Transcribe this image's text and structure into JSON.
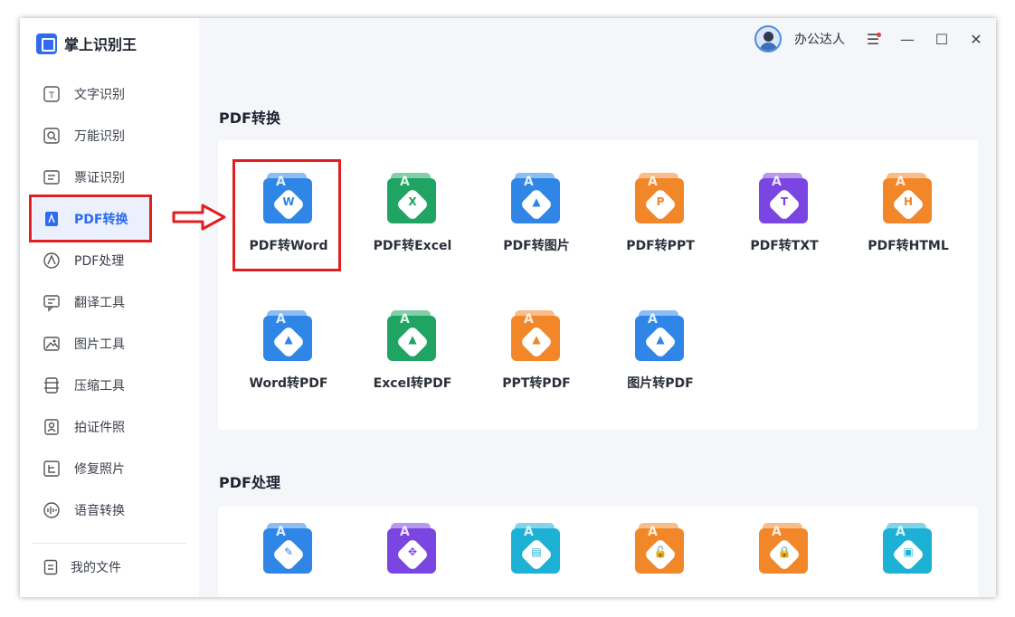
{
  "app": {
    "title": "掌上识别王"
  },
  "user": {
    "name": "办公达人"
  },
  "window": {
    "menu": "☰",
    "minimize": "—",
    "maximize": "☐",
    "close": "✕"
  },
  "sidebar": {
    "items": [
      {
        "label": "文字识别",
        "icon": "text-recognition-icon"
      },
      {
        "label": "万能识别",
        "icon": "universal-recognition-icon"
      },
      {
        "label": "票证识别",
        "icon": "ticket-recognition-icon"
      },
      {
        "label": "PDF转换",
        "icon": "pdf-convert-icon",
        "active": true
      },
      {
        "label": "PDF处理",
        "icon": "pdf-process-icon"
      },
      {
        "label": "翻译工具",
        "icon": "translate-icon"
      },
      {
        "label": "图片工具",
        "icon": "image-tools-icon"
      },
      {
        "label": "压缩工具",
        "icon": "compress-icon"
      },
      {
        "label": "拍证件照",
        "icon": "id-photo-icon"
      },
      {
        "label": "修复照片",
        "icon": "photo-repair-icon"
      },
      {
        "label": "语音转换",
        "icon": "voice-convert-icon"
      }
    ],
    "bottom": {
      "label": "我的文件",
      "icon": "my-files-icon"
    }
  },
  "sections": {
    "pdf_convert": {
      "title": "PDF转换",
      "tools": [
        {
          "label": "PDF转Word",
          "glyph": "W",
          "color": "#2f86e6",
          "accent": "#2f86e6"
        },
        {
          "label": "PDF转Excel",
          "glyph": "X",
          "color": "#1fa463",
          "accent": "#1fa463"
        },
        {
          "label": "PDF转图片",
          "glyph": "▲",
          "color": "#2f86e6",
          "accent": "#2f86e6"
        },
        {
          "label": "PDF转PPT",
          "glyph": "P",
          "color": "#f2872a",
          "accent": "#f2872a"
        },
        {
          "label": "PDF转TXT",
          "glyph": "T",
          "color": "#7a45e0",
          "accent": "#7a45e0"
        },
        {
          "label": "PDF转HTML",
          "glyph": "H",
          "color": "#f2872a",
          "accent": "#f2872a"
        },
        {
          "label": "Word转PDF",
          "glyph": "▲",
          "color": "#2f86e6",
          "accent": "#2f86e6"
        },
        {
          "label": "Excel转PDF",
          "glyph": "▲",
          "color": "#1fa463",
          "accent": "#1fa463"
        },
        {
          "label": "PPT转PDF",
          "glyph": "▲",
          "color": "#f2872a",
          "accent": "#f2872a"
        },
        {
          "label": "图片转PDF",
          "glyph": "▲",
          "color": "#2f86e6",
          "accent": "#2f86e6"
        }
      ]
    },
    "pdf_process": {
      "title": "PDF处理",
      "tools": [
        {
          "glyph": "✎",
          "color": "#2f86e6",
          "accent": "#2f86e6"
        },
        {
          "glyph": "✥",
          "color": "#7a45e0",
          "accent": "#7a45e0"
        },
        {
          "glyph": "▤",
          "color": "#1eb1d6",
          "accent": "#1eb1d6"
        },
        {
          "glyph": "🔓",
          "color": "#f2872a",
          "accent": "#f2872a"
        },
        {
          "glyph": "🔒",
          "color": "#f2872a",
          "accent": "#f2872a"
        },
        {
          "glyph": "▣",
          "color": "#1eb1d6",
          "accent": "#1eb1d6"
        }
      ]
    }
  }
}
